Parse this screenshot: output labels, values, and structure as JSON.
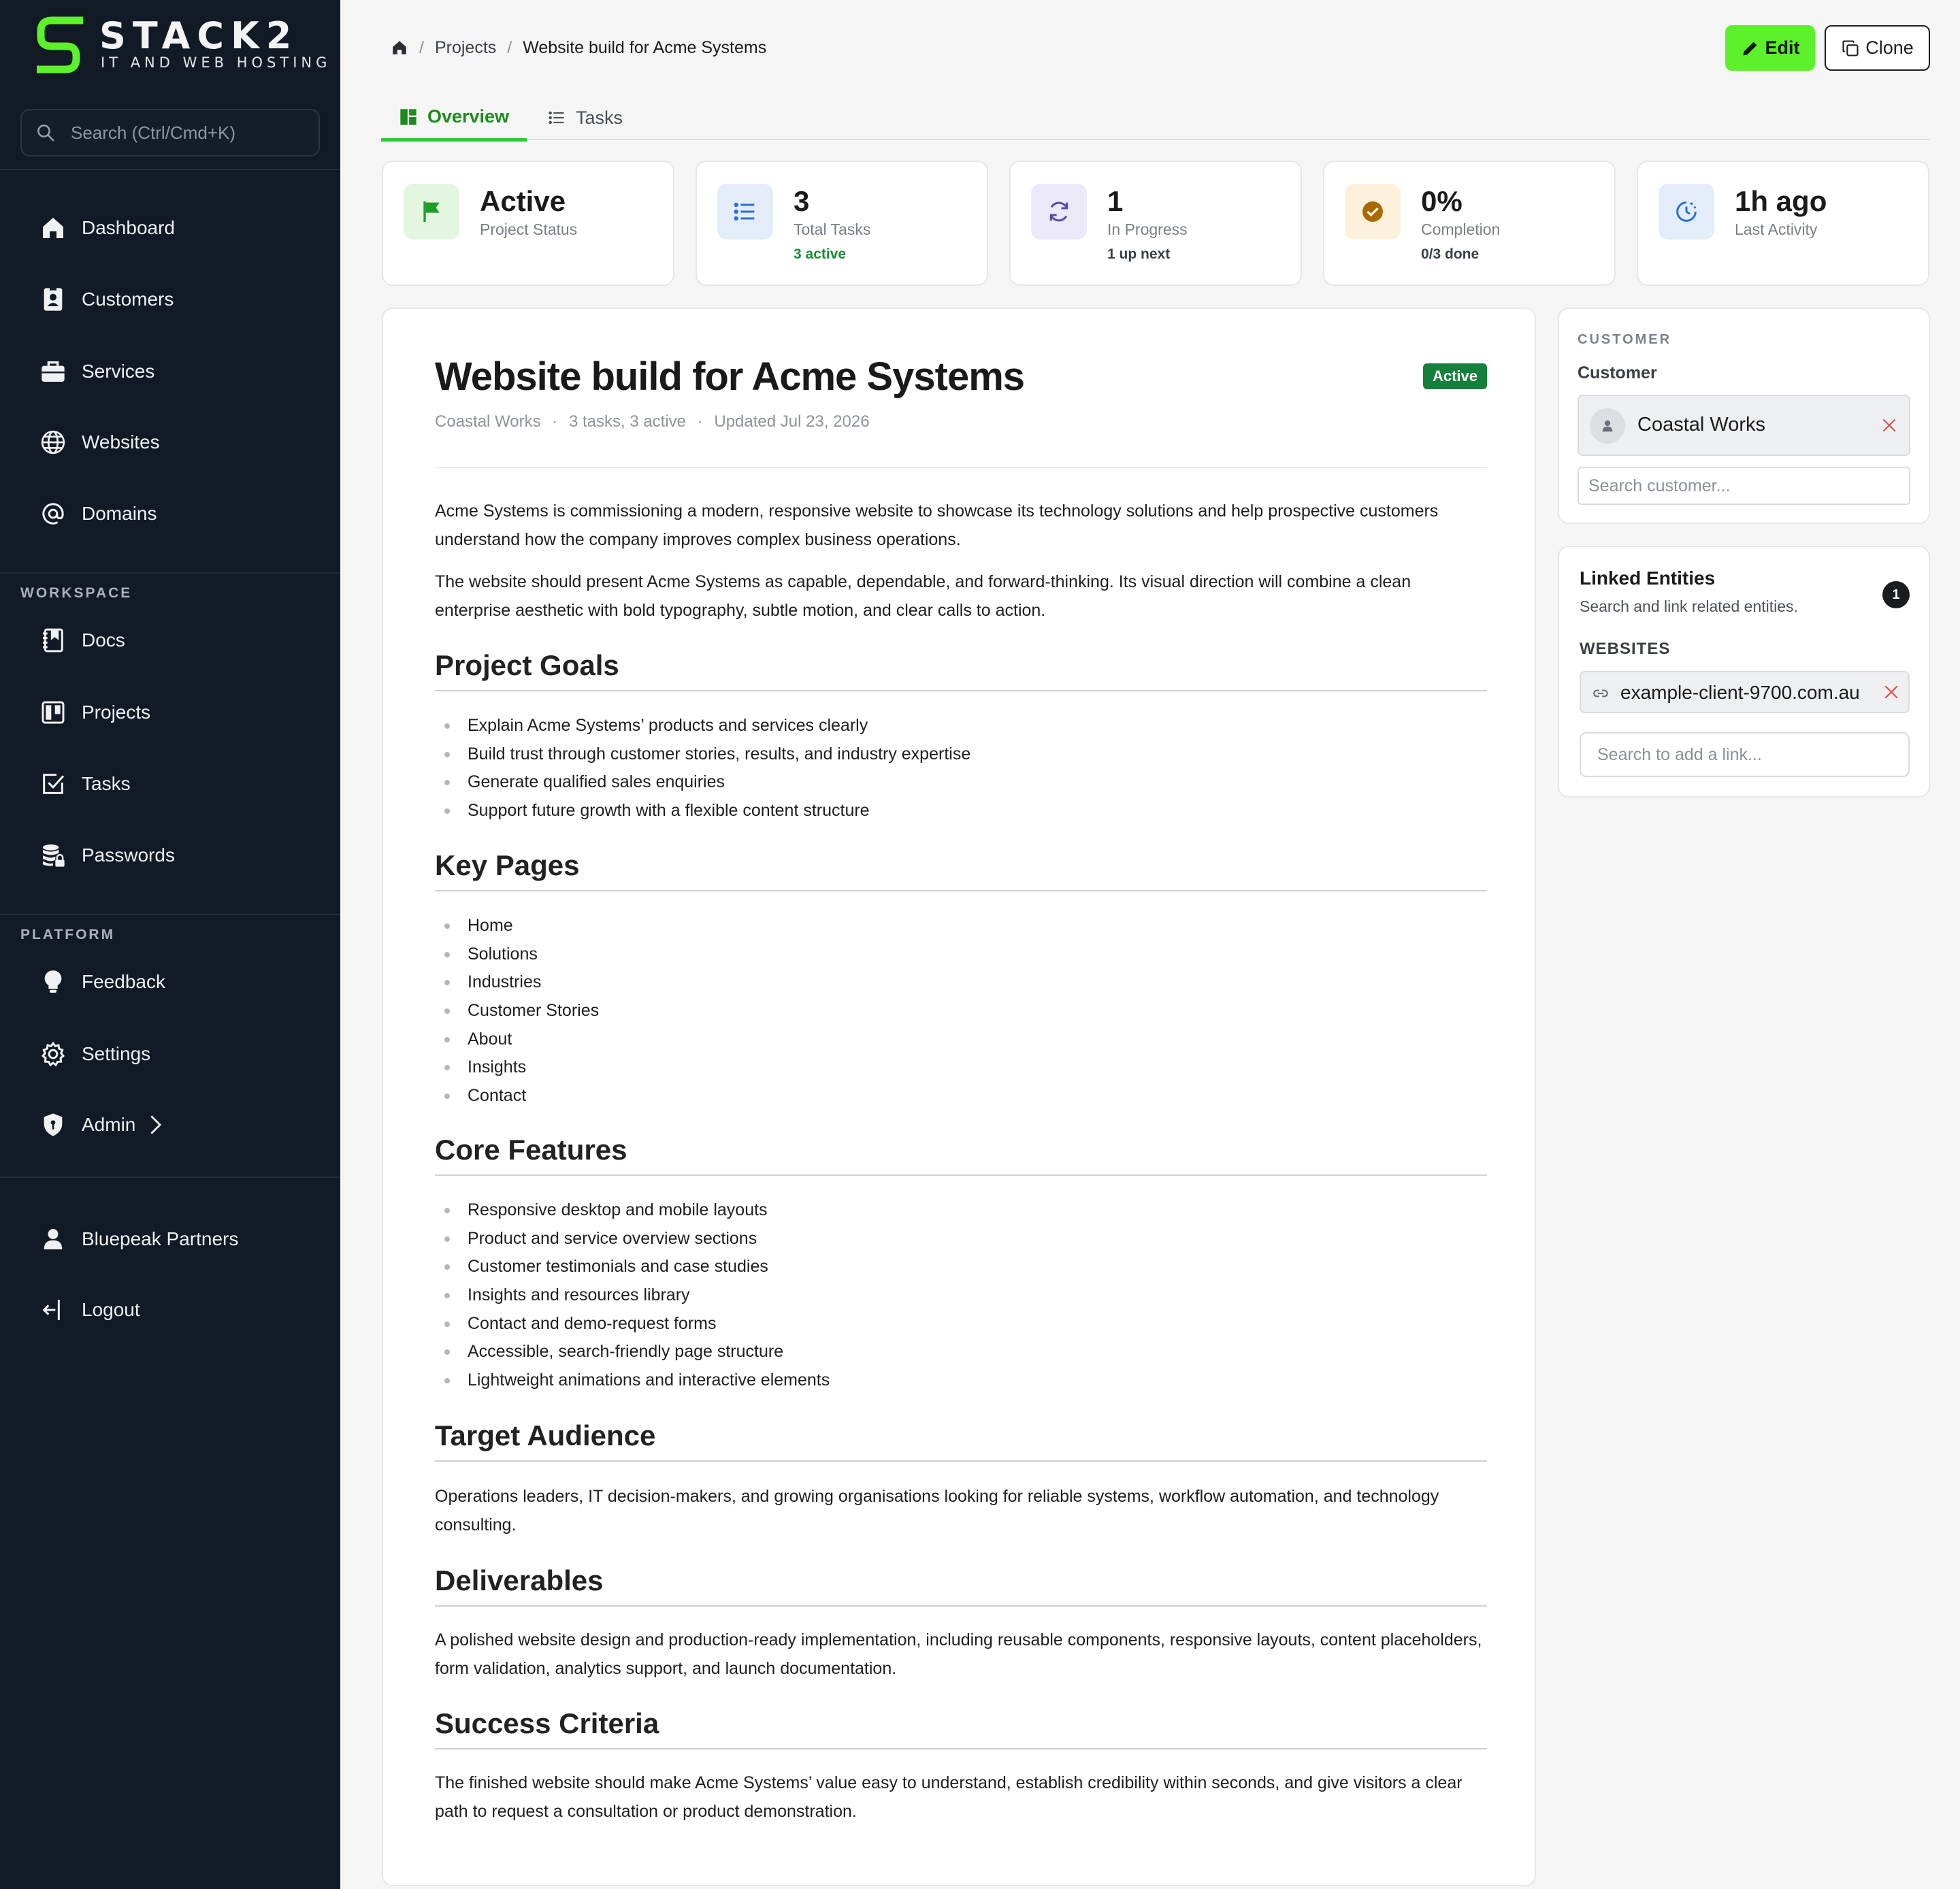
{
  "brand": {
    "name": "STACK2",
    "tagline": "IT AND WEB HOSTING",
    "accent": "#5cf12a"
  },
  "sidebar": {
    "search_placeholder": "Search (Ctrl/Cmd+K)",
    "main": [
      {
        "label": "Dashboard",
        "icon": "home-icon"
      },
      {
        "label": "Customers",
        "icon": "contact-card-icon"
      },
      {
        "label": "Services",
        "icon": "briefcase-icon"
      },
      {
        "label": "Websites",
        "icon": "globe-icon"
      },
      {
        "label": "Domains",
        "icon": "at-sign-icon"
      }
    ],
    "workspace_label": "WORKSPACE",
    "workspace": [
      {
        "label": "Docs",
        "icon": "notebook-icon"
      },
      {
        "label": "Projects",
        "icon": "kanban-icon"
      },
      {
        "label": "Tasks",
        "icon": "checkbox-icon"
      },
      {
        "label": "Passwords",
        "icon": "database-lock-icon"
      }
    ],
    "platform_label": "PLATFORM",
    "platform": [
      {
        "label": "Feedback",
        "icon": "lightbulb-icon"
      },
      {
        "label": "Settings",
        "icon": "gear-icon"
      },
      {
        "label": "Admin",
        "icon": "shield-icon"
      }
    ],
    "account": [
      {
        "label": "Bluepeak Partners",
        "icon": "user-icon"
      },
      {
        "label": "Logout",
        "icon": "logout-icon"
      }
    ]
  },
  "breadcrumb": {
    "items": [
      "Projects",
      "Website build for Acme Systems"
    ]
  },
  "actions": {
    "edit": "Edit",
    "clone": "Clone"
  },
  "tabs": [
    {
      "label": "Overview"
    },
    {
      "label": "Tasks"
    }
  ],
  "stats": [
    {
      "value": "Active",
      "label": "Project Status",
      "sub": "",
      "icon": "flag-icon",
      "color": "#1f9d2a",
      "bg": "#e2f6e0"
    },
    {
      "value": "3",
      "label": "Total Tasks",
      "sub": "3 active",
      "icon": "list-icon",
      "color": "#2a6fd6",
      "bg": "#e3edfa"
    },
    {
      "value": "1",
      "label": "In Progress",
      "sub": "1 up next",
      "icon": "refresh-icon",
      "color": "#5a4bb0",
      "bg": "#ebe8f7"
    },
    {
      "value": "0%",
      "label": "Completion",
      "sub": "0/3 done",
      "icon": "check-circle-icon",
      "color": "#a86a00",
      "bg": "#fdf1dc"
    },
    {
      "value": "1h ago",
      "label": "Last Activity",
      "sub": "",
      "icon": "clock-icon",
      "color": "#2a6fd6",
      "bg": "#e3edfa"
    }
  ],
  "doc": {
    "title": "Website build for Acme Systems",
    "status": "Active",
    "meta": {
      "customer": "Coastal Works",
      "tasks": "3 tasks, 3 active",
      "updated": "Updated Jul 23, 2026"
    },
    "intro": [
      "Acme Systems is commissioning a modern, responsive website to showcase its technology solutions and help prospective customers understand how the company improves complex business operations.",
      "The website should present Acme Systems as capable, dependable, and forward-thinking. Its visual direction will combine a clean enterprise aesthetic with bold typography, subtle motion, and clear calls to action."
    ],
    "goals_heading": "Project Goals",
    "goals": [
      "Explain Acme Systems’ products and services clearly",
      "Build trust through customer stories, results, and industry expertise",
      "Generate qualified sales enquiries",
      "Support future growth with a flexible content structure"
    ],
    "pages_heading": "Key Pages",
    "pages": [
      "Home",
      "Solutions",
      "Industries",
      "Customer Stories",
      "About",
      "Insights",
      "Contact"
    ],
    "features_heading": "Core Features",
    "features": [
      "Responsive desktop and mobile layouts",
      "Product and service overview sections",
      "Customer testimonials and case studies",
      "Insights and resources library",
      "Contact and demo-request forms",
      "Accessible, search-friendly page structure",
      "Lightweight animations and interactive elements"
    ],
    "audience_heading": "Target Audience",
    "audience": "Operations leaders, IT decision-makers, and growing organisations looking for reliable systems, workflow automation, and technology consulting.",
    "deliverables_heading": "Deliverables",
    "deliverables": "A polished website design and production-ready implementation, including reusable components, responsive layouts, content placeholders, form validation, analytics support, and launch documentation.",
    "success_heading": "Success Criteria",
    "success": "The finished website should make Acme Systems’ value easy to understand, establish credibility within seconds, and give visitors a clear path to request a consultation or product demonstration."
  },
  "customer_panel": {
    "section": "CUSTOMER",
    "label": "Customer",
    "selected": "Coastal Works",
    "search_placeholder": "Search customer..."
  },
  "linked_panel": {
    "title": "Linked Entities",
    "subtitle": "Search and link related entities.",
    "count": "1",
    "section": "WEBSITES",
    "link": "example-client-9700.com.au",
    "search_placeholder": "Search to add a link..."
  }
}
